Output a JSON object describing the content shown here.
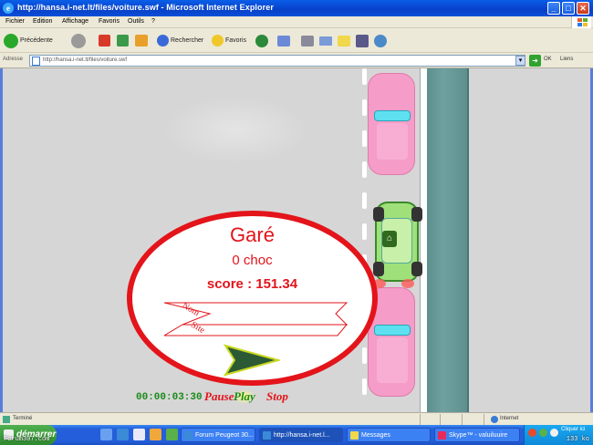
{
  "window": {
    "title": "http://hansa.i-net.lt/files/voiture.swf - Microsoft Internet Explorer",
    "minimize": "_",
    "maximize": "□",
    "close": "✕"
  },
  "menu": [
    "Fichier",
    "Edition",
    "Affichage",
    "Favoris",
    "Outils",
    "?"
  ],
  "toolbar": {
    "back": "Précédente",
    "search": "Rechercher",
    "favorites": "Favoris"
  },
  "address": {
    "label": "Adresse",
    "url": "http://hansa.i-net.lt/files/voiture.swf",
    "go": "OK",
    "links": "Liens"
  },
  "game": {
    "result_title": "Garé",
    "crashes": "0 choc",
    "score": "score : 151.34",
    "name_label": "Nom",
    "site_label": "Site",
    "timer": "00:00:03:30",
    "pause": "Pause",
    "play": "Play",
    "stop": "Stop"
  },
  "status": {
    "text": "Terminé",
    "zone": "Internet"
  },
  "taskbar": {
    "start": "démarrer",
    "watermark": "Forum307.com",
    "tasks": [
      "Forum Peugeot 30...",
      "http://hansa.i-net.l...",
      "Messages",
      "Skype™ - valuiluuire"
    ],
    "tray_text": "Cliquer ici",
    "clock": "133 ko"
  },
  "colors": {
    "accent_red": "#e3141a",
    "timer_green": "#1a8a1a",
    "road": "#d6d6d6",
    "water": "#5d8f8e"
  }
}
